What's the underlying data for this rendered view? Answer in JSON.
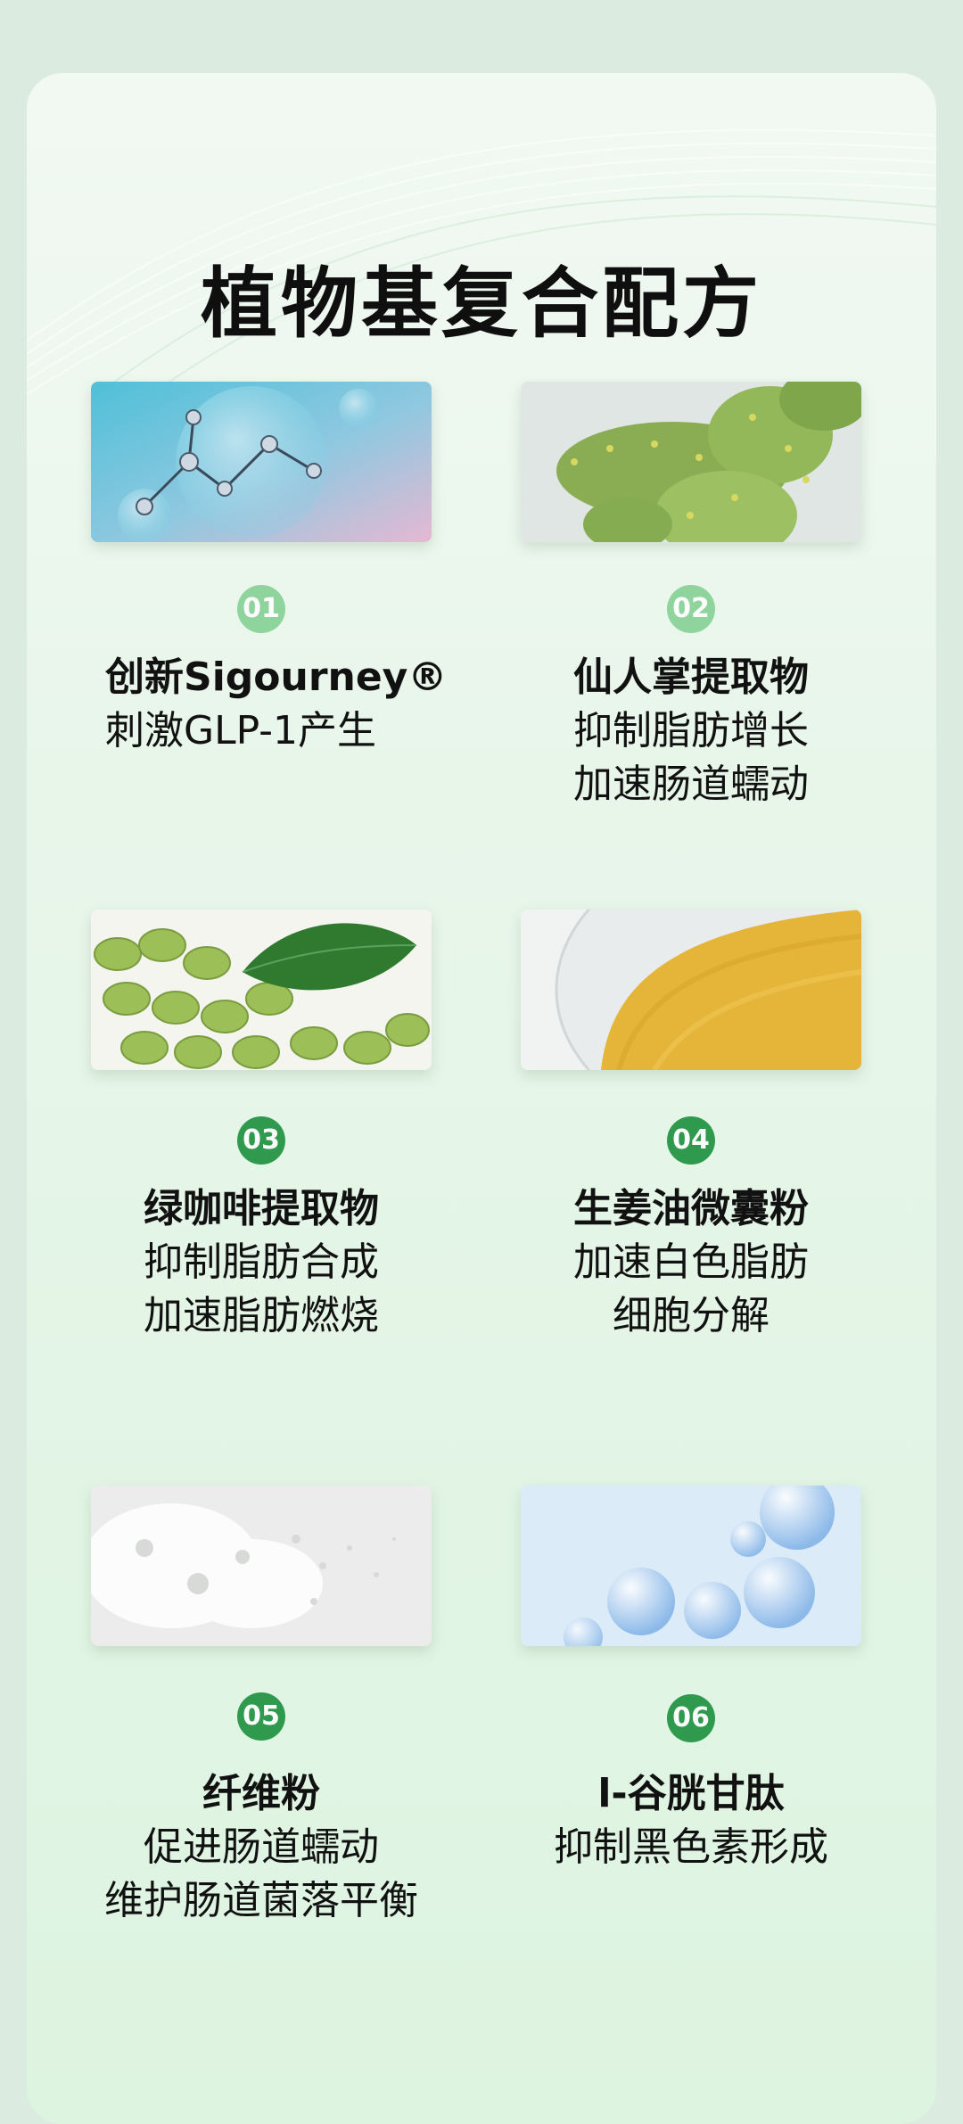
{
  "title": "植物基复合配方",
  "items": [
    {
      "number": "01",
      "heading": "创新Sigourney®",
      "lines": [
        "刺激GLP-1产生"
      ],
      "image": "molecule-bubbles-image"
    },
    {
      "number": "02",
      "heading": "仙人掌提取物",
      "lines": [
        "抑制脂肪增长",
        "加速肠道蠕动"
      ],
      "image": "cactus-image"
    },
    {
      "number": "03",
      "heading": "绿咖啡提取物",
      "lines": [
        "抑制脂肪合成",
        "加速脂肪燃烧"
      ],
      "image": "green-coffee-beans-image"
    },
    {
      "number": "04",
      "heading": "生姜油微囊粉",
      "lines": [
        "加速白色脂肪",
        "细胞分解"
      ],
      "image": "ginger-powder-image"
    },
    {
      "number": "05",
      "heading": "纤维粉",
      "lines": [
        "促进肠道蠕动",
        "维护肠道菌落平衡"
      ],
      "image": "white-fiber-powder-image"
    },
    {
      "number": "06",
      "heading": "l-谷胱甘肽",
      "lines": [
        "抑制黑色素形成"
      ],
      "image": "blue-bubbles-image"
    }
  ],
  "colors": {
    "badge_light": "#8fd49c",
    "badge_dark": "#2f9a4e",
    "background": "#dcebdf"
  }
}
